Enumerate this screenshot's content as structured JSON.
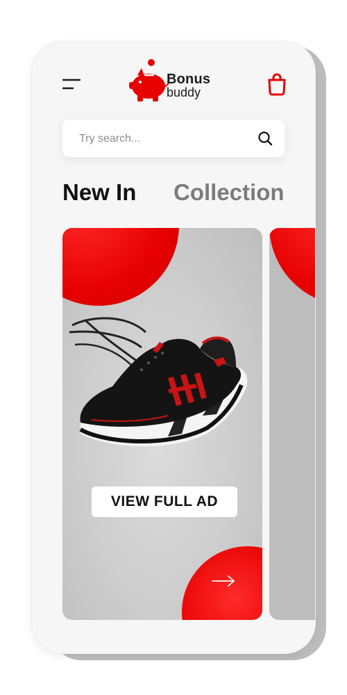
{
  "brand": {
    "line1": "Bonus",
    "line2": "buddy",
    "accent": "#e60000"
  },
  "header": {
    "menu_icon": "hamburger-menu-icon",
    "cart_icon": "shopping-bag-icon"
  },
  "search": {
    "placeholder": "Try search...",
    "value": "",
    "icon": "search-icon"
  },
  "tabs": [
    {
      "label": "New In",
      "active": true
    },
    {
      "label": "Collection",
      "active": false
    }
  ],
  "cards": [
    {
      "product_image": "black-red-sneaker",
      "cta_label": "VIEW FULL AD",
      "arrow_icon": "arrow-right-icon"
    }
  ]
}
